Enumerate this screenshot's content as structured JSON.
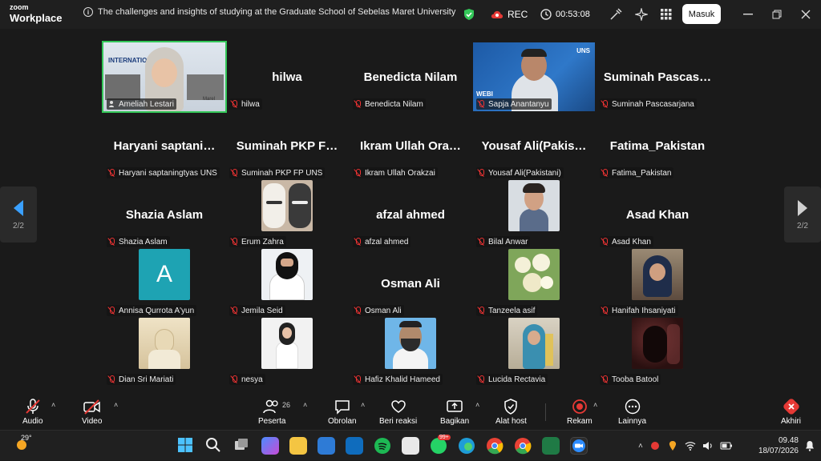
{
  "app": {
    "brand_line1": "zoom",
    "brand_line2": "Workplace"
  },
  "meeting": {
    "title": "The challenges and insights of studying at the Graduate School of Sebelas Maret University",
    "rec_label": "REC",
    "timer": "00:53:08",
    "sign_in_label": "Masuk"
  },
  "pager": {
    "left": "2/2",
    "right": "2/2"
  },
  "participants": [
    {
      "name": "Ameliah Lestari",
      "display": "",
      "type": "video"
    },
    {
      "name": "hilwa",
      "display": "hilwa",
      "type": "name"
    },
    {
      "name": "Benedicta Nilam",
      "display": "Benedicta Nilam",
      "type": "name"
    },
    {
      "name": "Sapja Anantanyu",
      "display": "",
      "type": "video"
    },
    {
      "name": "Suminah Pascasarjana",
      "display": "Suminah  Pascas…",
      "type": "name"
    },
    {
      "name": "Haryani saptaningtyas UNS",
      "display": "Haryani  saptani…",
      "type": "name"
    },
    {
      "name": "Suminah PKP FP UNS",
      "display": "Suminah PKP F…",
      "type": "name"
    },
    {
      "name": "Ikram Ullah Orakzai",
      "display": "Ikram Ullah Ora…",
      "type": "name"
    },
    {
      "name": "Yousaf Ali(Pakistani)",
      "display": "Yousaf  Ali(Pakis…",
      "type": "name"
    },
    {
      "name": "Fatima_Pakistan",
      "display": "Fatima_Pakistan",
      "type": "name"
    },
    {
      "name": "Shazia Aslam",
      "display": "Shazia Aslam",
      "type": "name"
    },
    {
      "name": "Erum Zahra",
      "display": "",
      "type": "picture"
    },
    {
      "name": "afzal ahmed",
      "display": "afzal ahmed",
      "type": "name"
    },
    {
      "name": "Bilal Anwar",
      "display": "",
      "type": "picture"
    },
    {
      "name": "Asad Khan",
      "display": "Asad Khan",
      "type": "name"
    },
    {
      "name": "Annisa Qurrota A'yun",
      "display": "A",
      "type": "letter"
    },
    {
      "name": "Jemila Seid",
      "display": "",
      "type": "picture"
    },
    {
      "name": "Osman Ali",
      "display": "Osman Ali",
      "type": "name"
    },
    {
      "name": "Tanzeela asif",
      "display": "",
      "type": "picture"
    },
    {
      "name": "Hanifah Ihsaniyati",
      "display": "",
      "type": "picture"
    },
    {
      "name": "Dian Sri Mariati",
      "display": "",
      "type": "picture"
    },
    {
      "name": "nesya",
      "display": "",
      "type": "picture"
    },
    {
      "name": "Hafiz Khalid Hameed",
      "display": "",
      "type": "picture"
    },
    {
      "name": "Lucida Rectavia",
      "display": "",
      "type": "picture"
    },
    {
      "name": "Tooba Batool",
      "display": "",
      "type": "picture"
    }
  ],
  "video_overlays": {
    "ameliah_banner": "INTERNATION",
    "ameliah_date": "Marel",
    "sapja_banner": "WEBI",
    "sapja_logo": "UNS"
  },
  "toolbar": {
    "audio": "Audio",
    "video": "Video",
    "participants": "Peserta",
    "participants_count": "26",
    "chat": "Obrolan",
    "react": "Beri reaksi",
    "share": "Bagikan",
    "host_tools": "Alat host",
    "record": "Rekam",
    "more": "Lainnya",
    "end": "Akhiri"
  },
  "taskbar": {
    "weather_temp": "29°",
    "badge": "99+",
    "time": "09.48",
    "date": "18/07/2026"
  },
  "colors": {
    "accent_green": "#34c759",
    "red": "#e53935",
    "blue_nav": "#3aa0ff"
  }
}
